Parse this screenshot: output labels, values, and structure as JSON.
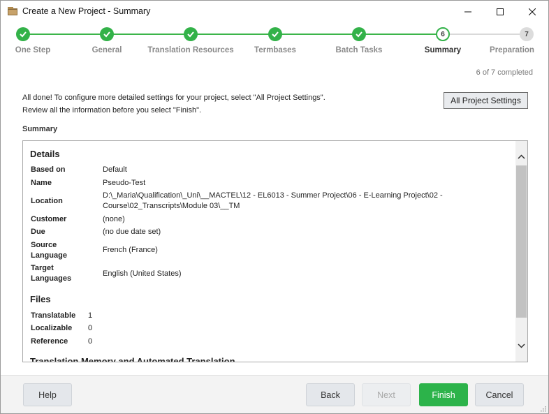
{
  "window": {
    "title": "Create a New Project - Summary"
  },
  "stepper": {
    "steps": [
      {
        "label": "One Step",
        "state": "done"
      },
      {
        "label": "General",
        "state": "done"
      },
      {
        "label": "Translation Resources",
        "state": "done"
      },
      {
        "label": "Termbases",
        "state": "done"
      },
      {
        "label": "Batch Tasks",
        "state": "done"
      },
      {
        "label": "Summary",
        "state": "current",
        "number": "6"
      },
      {
        "label": "Preparation",
        "state": "todo",
        "number": "7"
      }
    ],
    "progress_text": "6 of 7 completed"
  },
  "intro": {
    "line1": "All done! To configure more detailed settings for your project, select \"All Project Settings\".",
    "line2": "Review all the information before you select \"Finish\".",
    "all_settings_button": "All Project Settings",
    "summary_heading": "Summary"
  },
  "details": {
    "title": "Details",
    "based_on_label": "Based on",
    "based_on_value": "Default",
    "name_label": "Name",
    "name_value": "Pseudo-Test",
    "location_label": "Location",
    "location_value_line1": "D:\\_Maria\\Qualification\\_Uni\\__MACTEL\\12 - EL6013 - Summer Project\\06 - E-Learning Project\\02 -",
    "location_value_line2": "Course\\02_Transcripts\\Module 03\\__TM",
    "customer_label": "Customer",
    "customer_value": "(none)",
    "due_label": "Due",
    "due_value": "(no due date set)",
    "source_label_line1": "Source",
    "source_label_line2": "Language",
    "source_value": "French (France)",
    "target_label_line1": "Target",
    "target_label_line2": "Languages",
    "target_value": "English (United States)"
  },
  "files": {
    "title": "Files",
    "translatable_label": "Translatable",
    "translatable_value": "1",
    "localizable_label": "Localizable",
    "localizable_value": "0",
    "reference_label": "Reference",
    "reference_value": "0"
  },
  "tm_section": {
    "title": "Translation Memory and Automated Translation"
  },
  "footer": {
    "help": "Help",
    "back": "Back",
    "next": "Next",
    "finish": "Finish",
    "cancel": "Cancel"
  },
  "colors": {
    "accent_green": "#33b249",
    "finish_green": "#2cb34a"
  }
}
